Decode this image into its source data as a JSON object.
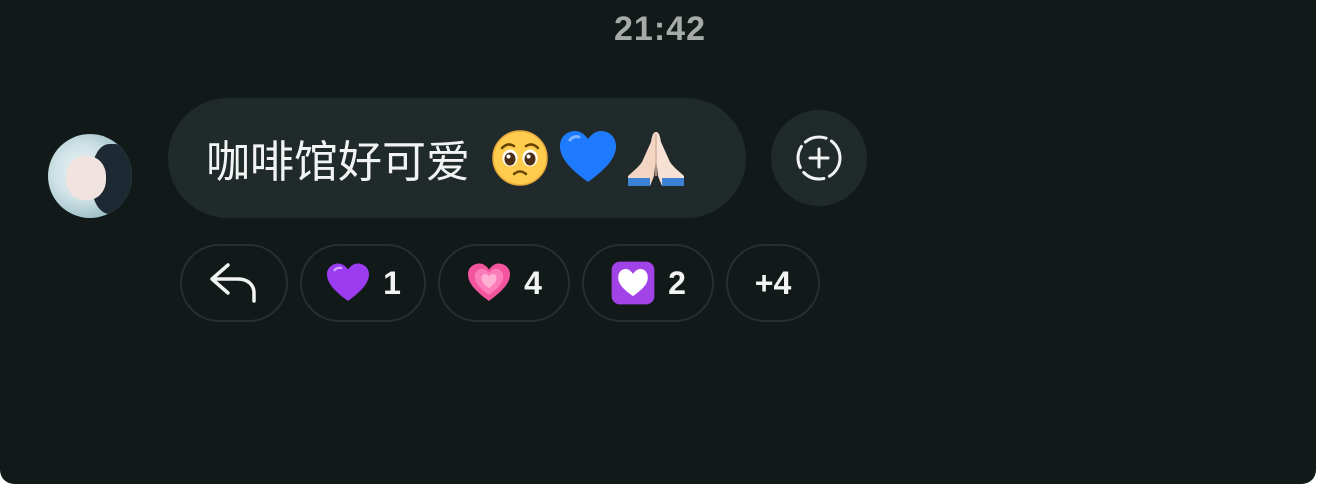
{
  "timestamp": "21:42",
  "message": {
    "text": "咖啡馆好可爱",
    "emoji_icons": [
      "pleading-face-icon",
      "blue-heart-icon",
      "folded-hands-icon"
    ]
  },
  "add_reaction": {
    "icon": "add-reaction-icon"
  },
  "reactions": [
    {
      "icon": "reply-arrow-icon",
      "count": ""
    },
    {
      "icon": "purple-heart-icon",
      "count": "1"
    },
    {
      "icon": "growing-heart-icon",
      "count": "4"
    },
    {
      "icon": "heart-box-icon",
      "count": "2"
    },
    {
      "icon": "",
      "count": "+4"
    }
  ],
  "colors": {
    "background": "#121919",
    "bubble": "#212a2a",
    "text": "#f2f4f4",
    "timestamp": "#a6aaa9",
    "chip_border": "#263030"
  }
}
